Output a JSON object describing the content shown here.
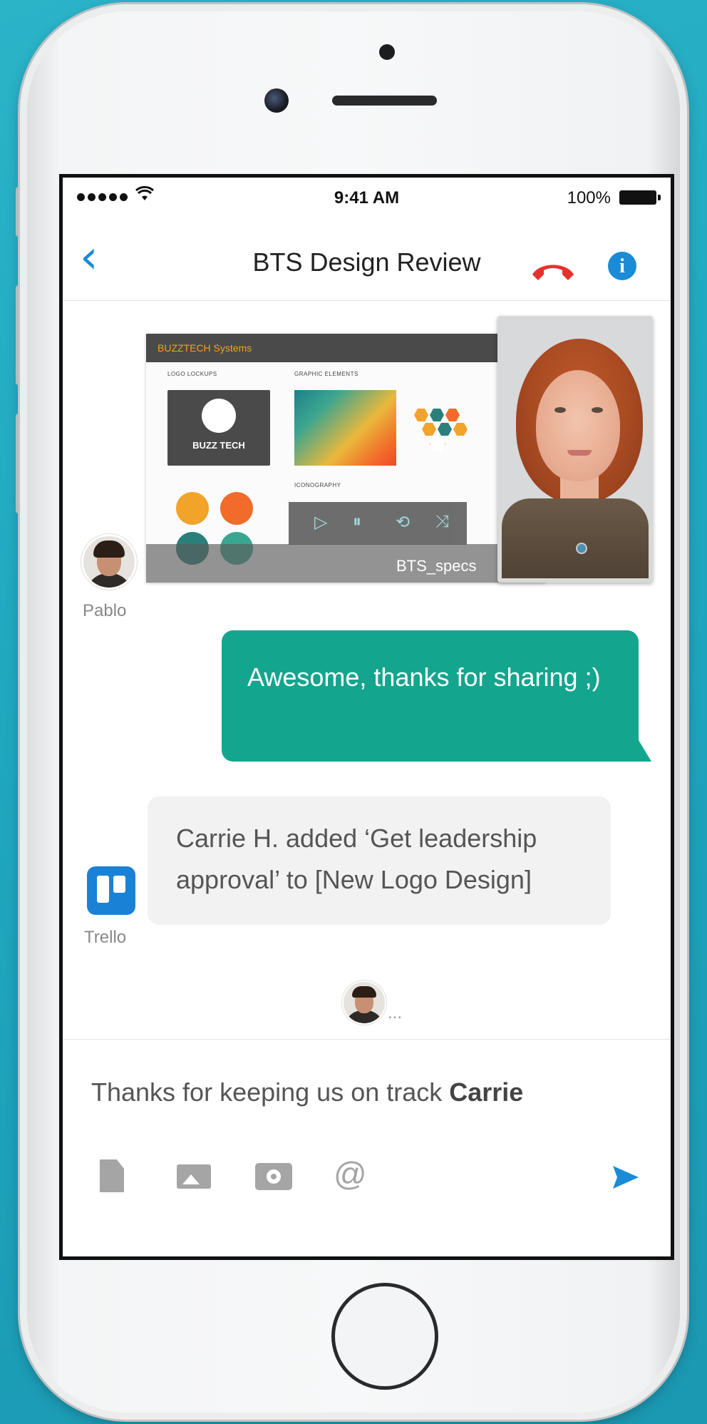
{
  "status_bar": {
    "time": "9:41 AM",
    "battery": "100%"
  },
  "nav": {
    "title": "BTS Design Review"
  },
  "shared_doc": {
    "header": "BUZZTECH Systems",
    "section_logo": "LOGO LOCKUPS",
    "section_graphic": "GRAPHIC ELEMENTS",
    "section_icon": "ICONOGRAPHY",
    "logo_text": "BUZZ TECH",
    "filename": "BTS_specs"
  },
  "messages": [
    {
      "sender": "Pablo"
    },
    {
      "text": "Awesome, thanks for sharing ;)"
    },
    {
      "sender": "Trello",
      "text": "Carrie H. added ‘Get leadership approval’ to [New Logo Design]"
    }
  ],
  "typing": "...",
  "composer": {
    "text": "Thanks for keeping us on track ",
    "mention": "Carrie"
  },
  "colors": {
    "accent": "#1a8bd6",
    "outgoing_bubble": "#14a58e",
    "hangup": "#e5322d"
  }
}
